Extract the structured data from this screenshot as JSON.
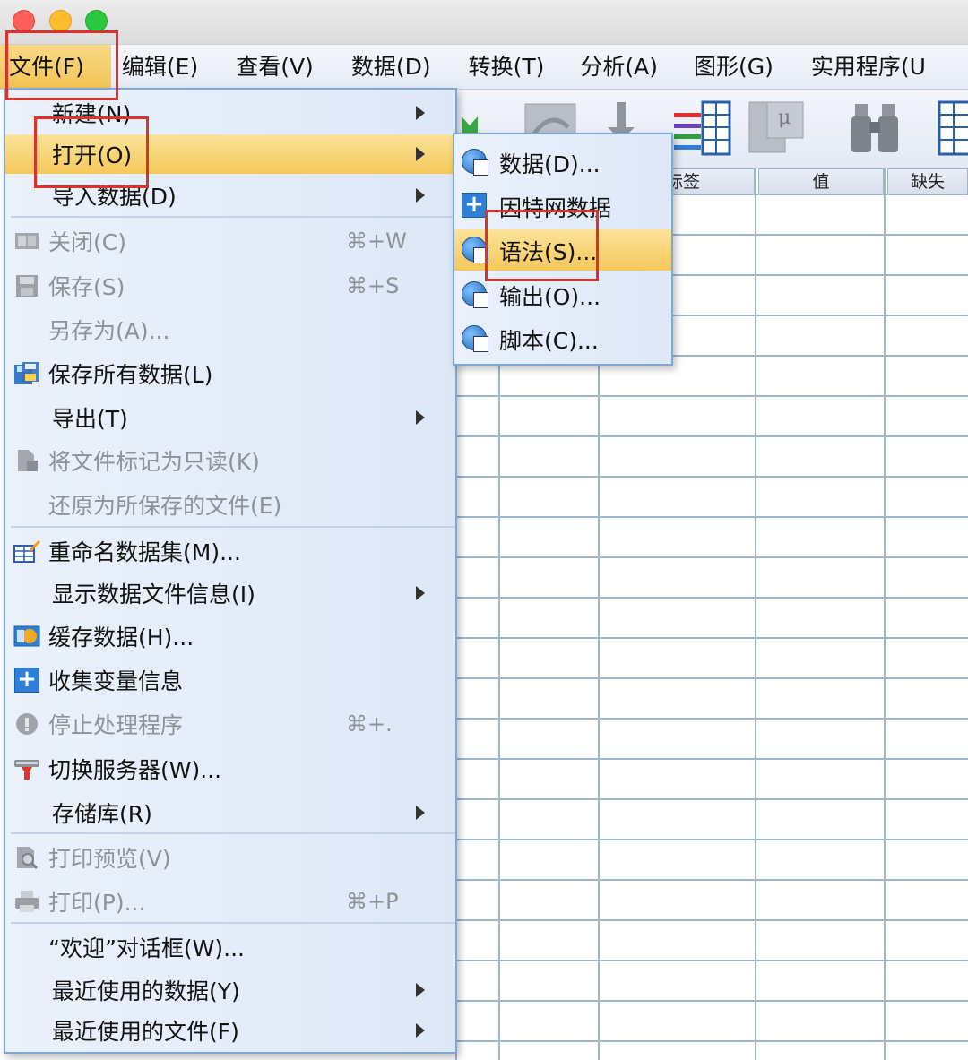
{
  "menubar": {
    "items": [
      "文件(F)",
      "编辑(E)",
      "查看(V)",
      "数据(D)",
      "转换(T)",
      "分析(A)",
      "图形(G)",
      "实用程序(U"
    ]
  },
  "grid": {
    "headers": [
      "标签",
      "值",
      "缺失"
    ]
  },
  "file_menu": {
    "items": [
      {
        "label": "新建(N)"
      },
      {
        "label": "打开(O)"
      },
      {
        "label": "导入数据(D)"
      },
      {
        "label": "关闭(C)",
        "shortcut": "⌘+W"
      },
      {
        "label": "保存(S)",
        "shortcut": "⌘+S"
      },
      {
        "label": "另存为(A)..."
      },
      {
        "label": "保存所有数据(L)"
      },
      {
        "label": "导出(T)"
      },
      {
        "label": "将文件标记为只读(K)"
      },
      {
        "label": "还原为所保存的文件(E)"
      },
      {
        "label": "重命名数据集(M)..."
      },
      {
        "label": "显示数据文件信息(I)"
      },
      {
        "label": "缓存数据(H)..."
      },
      {
        "label": "收集变量信息"
      },
      {
        "label": "停止处理程序",
        "shortcut": "⌘+."
      },
      {
        "label": "切换服务器(W)..."
      },
      {
        "label": "存储库(R)"
      },
      {
        "label": "打印预览(V)"
      },
      {
        "label": "打印(P)...",
        "shortcut": "⌘+P"
      },
      {
        "label": "“欢迎”对话框(W)..."
      },
      {
        "label": "最近使用的数据(Y)"
      },
      {
        "label": "最近使用的文件(F)"
      }
    ]
  },
  "open_submenu": {
    "items": [
      "数据(D)...",
      "因特网数据",
      "语法(S)...",
      "输出(O)...",
      "脚本(C)..."
    ]
  }
}
